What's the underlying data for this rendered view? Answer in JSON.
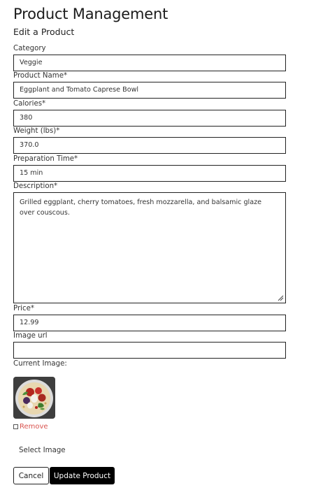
{
  "header": {
    "title": "Product Management",
    "subtitle": "Edit a Product"
  },
  "form": {
    "category": {
      "label": "Category",
      "value": "Veggie"
    },
    "product_name": {
      "label": "Product Name*",
      "value": "Eggplant and Tomato Caprese Bowl"
    },
    "calories": {
      "label": "Calories*",
      "value": "380"
    },
    "weight": {
      "label": "Weight (lbs)*",
      "value": "370.0"
    },
    "prep_time": {
      "label": "Preparation Time*",
      "value": "15 min"
    },
    "description": {
      "label": "Description*",
      "value": "Grilled eggplant, cherry tomatoes, fresh mozzarella, and balsamic glaze over couscous."
    },
    "price": {
      "label": "Price*",
      "value": "12.99"
    },
    "image_url": {
      "label": "Image url",
      "value": ""
    },
    "current_image": {
      "label": "Current Image:"
    },
    "remove_label": "Remove",
    "select_image_label": "Select Image"
  },
  "actions": {
    "cancel_label": "Cancel",
    "update_label": "Update Product"
  },
  "colors": {
    "remove_text": "#d9534f",
    "primary_button": "#000000"
  }
}
